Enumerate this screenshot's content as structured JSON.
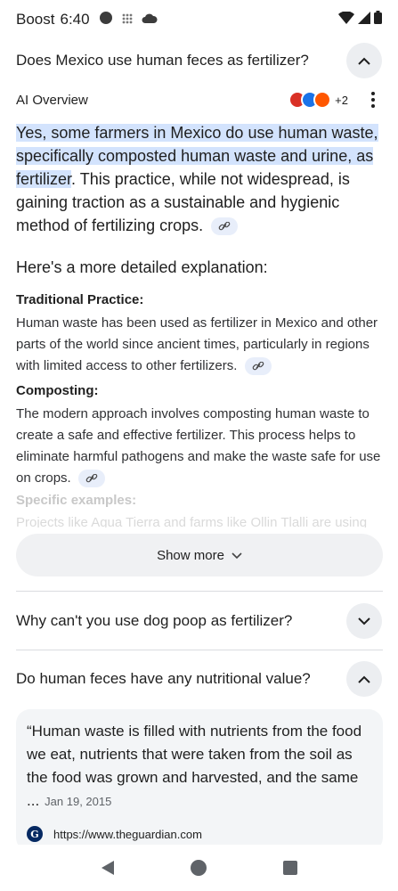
{
  "status_bar": {
    "carrier": "Boost",
    "time": "6:40",
    "icons": [
      "circle-notification-icon",
      "grid-icon",
      "cloud-icon",
      "wifi-icon",
      "signal-icon",
      "battery-icon"
    ]
  },
  "top_question": {
    "text": "Does Mexico use human feces as fertilizer?",
    "chevron": "chevron-up-icon"
  },
  "ai_overview": {
    "title": "AI Overview",
    "source_count": "+2",
    "source_colors": [
      "#d93025",
      "#1a73e8",
      "#ff5700"
    ],
    "answer_highlighted": "Yes, some farmers in Mexico do use human waste, specifically composted human waste and urine, as fertilizer",
    "answer_rest": ". This practice, while not widespread, is gaining traction as a sustainable and hygienic method of fertilizing crops.",
    "explain_intro": "Here's a more detailed explanation:",
    "sections": [
      {
        "heading": "Traditional Practice:",
        "body": "Human waste has been used as fertilizer in Mexico and other parts of the world since ancient times, particularly in regions with limited access to other fertilizers."
      },
      {
        "heading": "Composting:",
        "body": "The modern approach involves composting human waste to create a safe and effective fertilizer. This process helps to eliminate harmful pathogens and make the waste safe for use on crops."
      }
    ],
    "faded_heading": "Specific examples:",
    "faded_body": "Projects like Agua Tierra and farms like Ollin Tlalli are using",
    "show_more": "Show more"
  },
  "related_questions": [
    {
      "text": "Why can't you use dog poop as fertilizer?",
      "chevron": "chevron-down-icon"
    },
    {
      "text": "Do human feces have any nutritional value?",
      "chevron": "chevron-up-icon"
    }
  ],
  "quote_card": {
    "quote": "“Human waste is filled with nutrients from the food we eat, nutrients that were taken from the soil as the food was grown and harvested, and the same ...",
    "date": "Jan 19, 2015",
    "source_url": "https://www.theguardian.com",
    "logo_letter": "G"
  },
  "nav_bar": {
    "buttons": [
      "back-icon",
      "home-icon",
      "recents-icon"
    ]
  },
  "colors": {
    "highlight": "#d3e3fd",
    "chip_bg": "#eceef1",
    "card_bg": "#f3f5f7"
  }
}
